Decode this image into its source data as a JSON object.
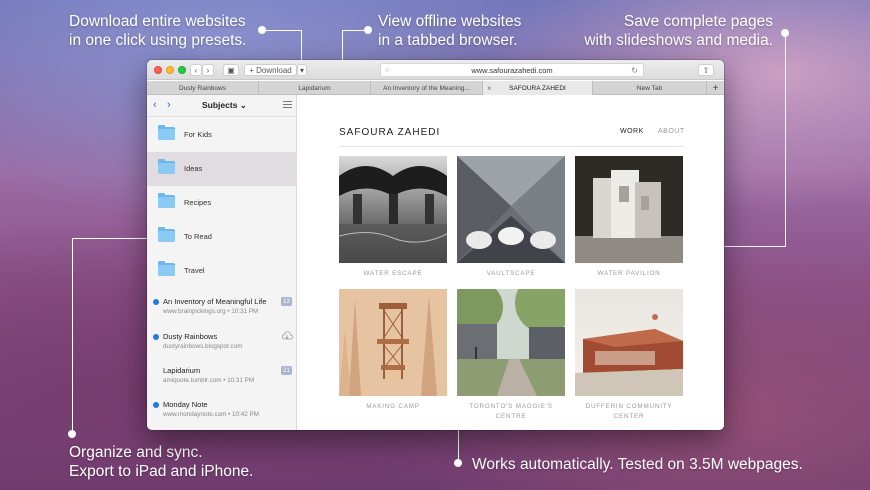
{
  "captions": {
    "download": [
      "Download entire websites",
      "in one click using presets."
    ],
    "tabbed": [
      "View offline websites",
      "in a tabbed browser."
    ],
    "save": [
      "Save complete pages",
      "with slideshows and media."
    ],
    "organize": [
      "Organize and sync.",
      "Export to iPad and iPhone."
    ],
    "works": [
      "Works automatically. Tested on 3.5M webpages."
    ]
  },
  "toolbar": {
    "download_label": "+ Download",
    "url": "www.safourazahedi.com"
  },
  "tabs": [
    {
      "label": "Dusty Rainbows",
      "active": false
    },
    {
      "label": "Lapidarium",
      "active": false
    },
    {
      "label": "An Inventory of the Meaning...",
      "active": false
    },
    {
      "label": "SAFOURA ZAHEDI",
      "active": true
    },
    {
      "label": "New Tab",
      "active": false
    }
  ],
  "sidebar": {
    "title": "Subjects",
    "folders": [
      "For Kids",
      "Ideas",
      "Recipes",
      "To Read",
      "Travel"
    ],
    "selected_folder": "Ideas",
    "pages": [
      {
        "title": "An Inventory of Meaningful Life",
        "sub": "www.brainpickings.org • 10:31 PM",
        "badge": "13",
        "unread": true
      },
      {
        "title": "Dusty Rainbows",
        "sub": "dustyrainbows.blogspot.com",
        "badge": "",
        "unread": true,
        "icon": "cloud-download-icon"
      },
      {
        "title": "Lapidarium",
        "sub": "amiquote.tumblr.com • 10:31 PM",
        "badge": "21",
        "unread": false
      },
      {
        "title": "Monday Note",
        "sub": "www.mondaynote.com • 10:42 PM",
        "badge": "",
        "unread": true
      }
    ]
  },
  "site": {
    "name": "SAFOURA ZAHEDI",
    "nav_work": "WORK",
    "nav_about": "ABOUT",
    "projects": [
      {
        "caption": "WATER ESCAPE"
      },
      {
        "caption": "VAULTSCAPE"
      },
      {
        "caption": "WATER PAVILION"
      },
      {
        "caption": "MAKING CAMP"
      },
      {
        "caption": "TORONTO'S MAGGIE'S CENTRE"
      },
      {
        "caption": "DUFFERIN COMMUNITY CENTER"
      }
    ]
  },
  "colors": {
    "accent": "#1e7ae6",
    "folder": "#6fb6ea"
  }
}
